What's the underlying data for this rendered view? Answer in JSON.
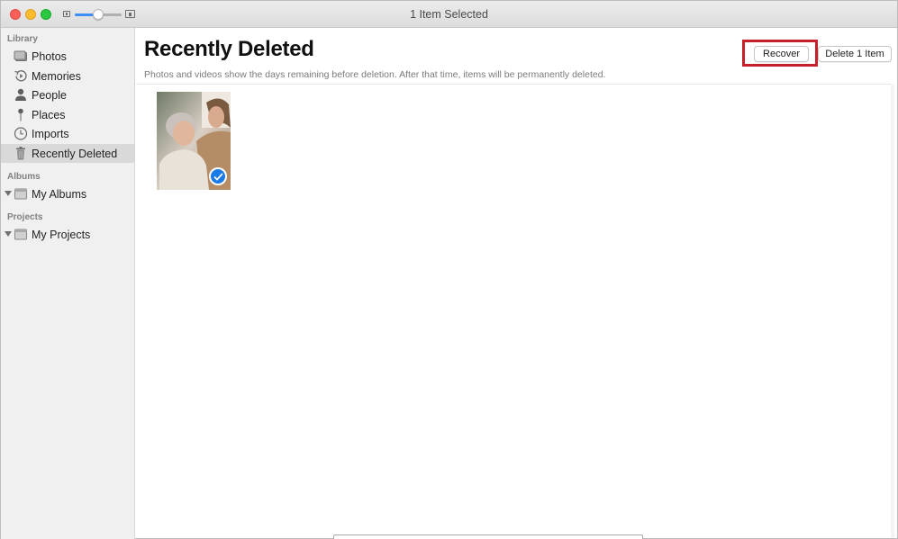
{
  "window": {
    "title": "1 Item Selected",
    "zoom_slider": {
      "value_fraction": 0.5
    },
    "accent_color": "#3d8ff7"
  },
  "sidebar": {
    "sections": [
      {
        "label": "Library",
        "items": [
          {
            "label": "Photos",
            "icon": "photos-icon",
            "selected": false
          },
          {
            "label": "Memories",
            "icon": "memories-icon",
            "selected": false
          },
          {
            "label": "People",
            "icon": "people-icon",
            "selected": false
          },
          {
            "label": "Places",
            "icon": "places-pin-icon",
            "selected": false
          },
          {
            "label": "Imports",
            "icon": "clock-icon",
            "selected": false
          },
          {
            "label": "Recently Deleted",
            "icon": "trash-icon",
            "selected": true
          }
        ]
      },
      {
        "label": "Albums",
        "items": [
          {
            "label": "My Albums",
            "icon": "folder-icon",
            "expandable": true
          }
        ]
      },
      {
        "label": "Projects",
        "items": [
          {
            "label": "My Projects",
            "icon": "folder-icon",
            "expandable": true
          }
        ]
      }
    ]
  },
  "main": {
    "title": "Recently Deleted",
    "subtitle": "Photos and videos show the days remaining before deletion. After that time, items will be permanently deleted.",
    "buttons": {
      "recover": "Recover",
      "delete": "Delete 1 Item"
    },
    "highlight_color": "#c8202a",
    "photos": [
      {
        "description": "Elderly woman smiling with younger woman",
        "selected": true
      }
    ]
  }
}
